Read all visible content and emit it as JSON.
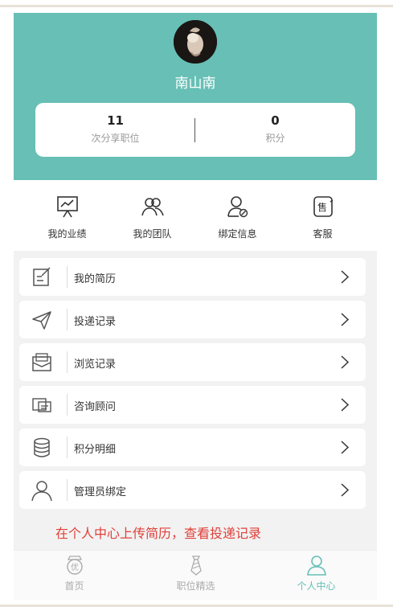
{
  "profile": {
    "username": "南山南",
    "stats": [
      {
        "value": "11",
        "label": "次分享职位"
      },
      {
        "value": "0",
        "label": "积分"
      }
    ]
  },
  "quick_actions": [
    {
      "label": "我的业绩",
      "icon": "presentation-chart-icon"
    },
    {
      "label": "我的团队",
      "icon": "team-icon"
    },
    {
      "label": "绑定信息",
      "icon": "user-bind-icon"
    },
    {
      "label": "客服",
      "icon": "service-icon"
    }
  ],
  "menu": [
    {
      "label": "我的简历",
      "icon": "edit-document-icon"
    },
    {
      "label": "投递记录",
      "icon": "paper-plane-icon"
    },
    {
      "label": "浏览记录",
      "icon": "envelope-icon"
    },
    {
      "label": "咨询顾问",
      "icon": "chat-icon"
    },
    {
      "label": "积分明细",
      "icon": "database-icon"
    },
    {
      "label": "管理员绑定",
      "icon": "person-icon"
    }
  ],
  "caption": "在个人中心上传简历，查看投递记录",
  "tabbar": [
    {
      "label": "首页",
      "icon": "home-badge-icon",
      "active": false
    },
    {
      "label": "职位精选",
      "icon": "tie-icon",
      "active": false
    },
    {
      "label": "个人中心",
      "icon": "person-icon",
      "active": true
    }
  ],
  "colors": {
    "accent": "#67bfb5",
    "caption": "#e0403a",
    "inactive_tab": "#aaaaaa"
  }
}
